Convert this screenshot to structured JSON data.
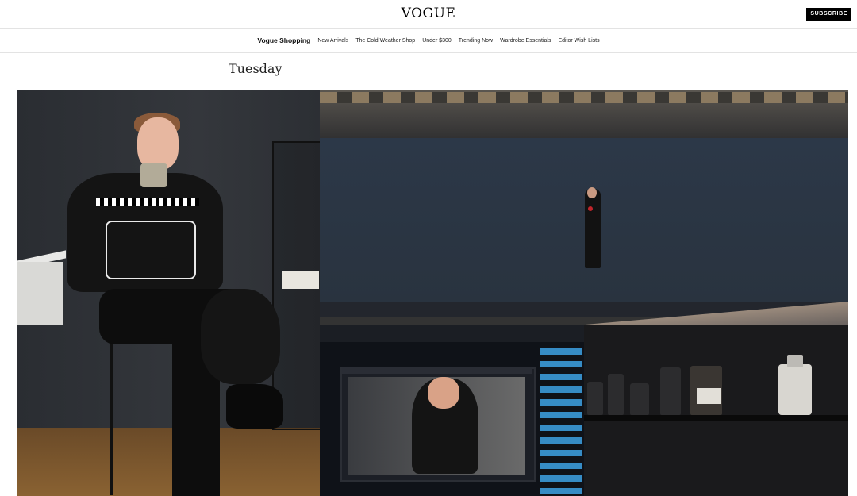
{
  "header": {
    "logo": "VOGUE",
    "subscribe_label": "SUBSCRIBE"
  },
  "nav": {
    "items": [
      "Vogue Shopping",
      "New Arrivals",
      "The Cold Weather Shop",
      "Under $300",
      "Trending Now",
      "Wardrobe Essentials",
      "Editor Wish Lists"
    ]
  },
  "article": {
    "day_title": "Tuesday"
  },
  "colors": {
    "brand_black": "#000000",
    "border": "#e3e3e3"
  }
}
